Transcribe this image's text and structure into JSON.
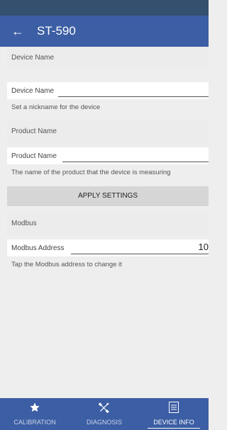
{
  "app_bar": {
    "title": "ST-590"
  },
  "sections": {
    "device": {
      "header": "Device Name",
      "field_label": "Device Name",
      "field_value": "",
      "hint": "Set a nickname for the device"
    },
    "product": {
      "header": "Product Name",
      "field_label": "Product Name",
      "field_value": "",
      "hint": "The name of the product that the device is measuring"
    },
    "apply_button": "APPLY SETTINGS",
    "modbus": {
      "header": "Modbus",
      "field_label": "Modbus Address",
      "field_value": "10",
      "hint": "Tap the Modbus address to change it"
    }
  },
  "bottom_nav": {
    "items": [
      {
        "label": "CALIBRATION",
        "icon": "star-icon",
        "active": false
      },
      {
        "label": "DIAGNOSIS",
        "icon": "tools-icon",
        "active": false
      },
      {
        "label": "DEVICE INFO",
        "icon": "document-icon",
        "active": true
      }
    ]
  }
}
